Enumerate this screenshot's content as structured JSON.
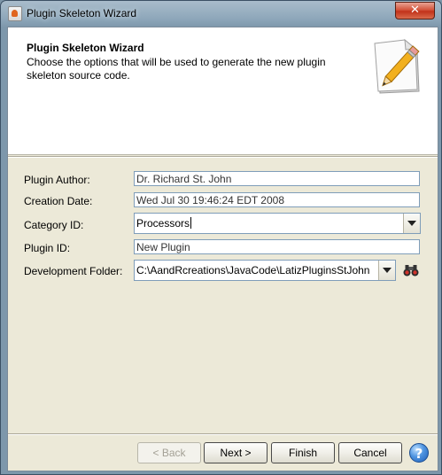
{
  "window": {
    "title": "Plugin Skeleton Wizard",
    "close_label": "✕"
  },
  "header": {
    "title": "Plugin Skeleton Wizard",
    "description": "Choose the options that will be used to generate the new plugin skeleton source code.",
    "icon": "notepad-pencil-icon"
  },
  "form": {
    "author_label": "Plugin Author:",
    "author_value": "Dr. Richard St. John",
    "date_label": "Creation Date:",
    "date_value": "Wed Jul 30 19:46:24 EDT 2008",
    "category_label": "Category ID:",
    "category_value": "Processors",
    "plugin_id_label": "Plugin ID:",
    "plugin_id_value": "New Plugin",
    "folder_label": "Development Folder:",
    "folder_value": "C:\\AandRcreations\\JavaCode\\LatizPluginsStJohn"
  },
  "buttons": {
    "back": "< Back",
    "next": "Next >",
    "finish": "Finish",
    "cancel": "Cancel",
    "help": "?"
  }
}
